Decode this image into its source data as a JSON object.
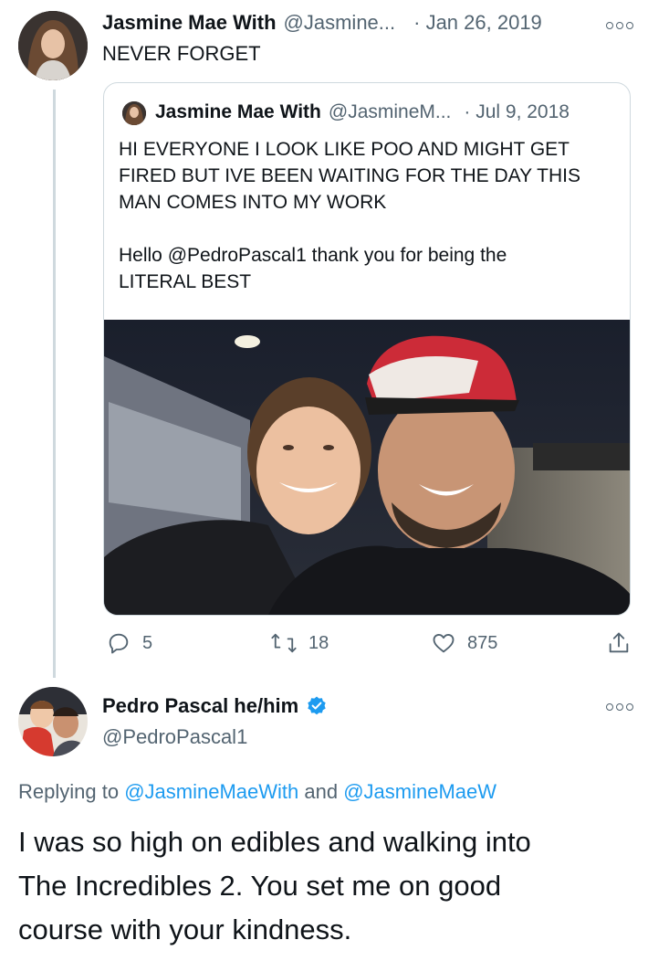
{
  "parent_tweet": {
    "display_name": "Jasmine Mae With",
    "handle": "@Jasmine...",
    "date": "· Jan 26, 2019",
    "text": "NEVER FORGET"
  },
  "quoted_tweet": {
    "display_name": "Jasmine Mae With",
    "handle": "@JasmineM...",
    "date": "· Jul 9, 2018",
    "line1": "HI EVERYONE I LOOK LIKE POO AND MIGHT GET",
    "line2": "FIRED BUT IVE BEEN WAITING FOR THE DAY THIS",
    "line3": "MAN COMES INTO MY WORK",
    "line4_prefix": "Hello ",
    "line4_mention": "@PedroPascal1",
    "line4_suffix": " thank you for being the",
    "line5": "LITERAL BEST"
  },
  "actions": {
    "replies": "5",
    "retweets": "18",
    "likes": "875"
  },
  "reply_tweet": {
    "display_name": "Pedro Pascal he/him",
    "handle": "@PedroPascal1",
    "replying_prefix": "Replying to ",
    "replying_user1": "@JasmineMaeWith",
    "replying_and": " and ",
    "replying_user2": "@JasmineMaeW",
    "line1": "I was so high on edibles and walking into",
    "line2": "The Incredibles 2. You set me on good",
    "line3": "course with your kindness."
  },
  "icons": {
    "reply": "reply-icon",
    "retweet": "retweet-icon",
    "like": "heart-icon",
    "share": "share-icon",
    "verified": "verified-badge-icon",
    "more": "more-options-icon"
  },
  "colors": {
    "accent": "#1d9bf0",
    "text": "#0f1419",
    "muted": "#536471",
    "border": "#cfd9de"
  }
}
